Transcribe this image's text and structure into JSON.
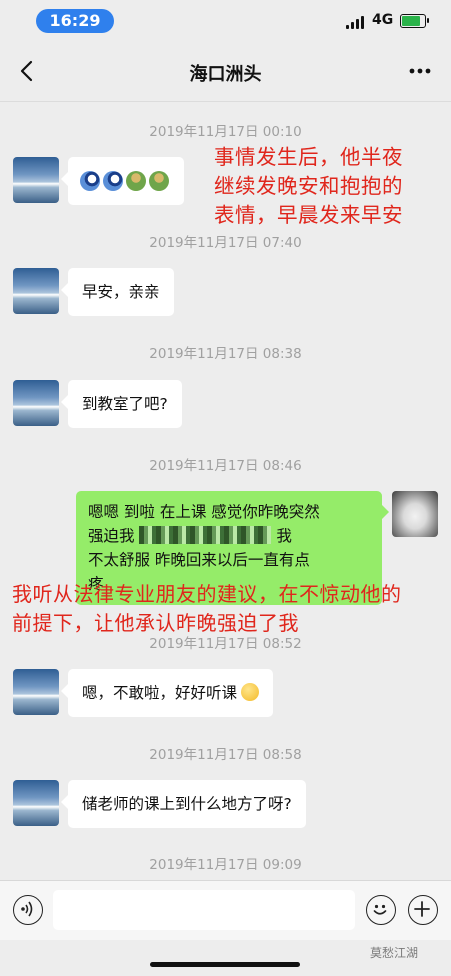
{
  "status_bar": {
    "time": "16:29",
    "network": "4G",
    "battery_level": 0.75,
    "battery_color": "#2ab34a",
    "time_pill_color": "#2f80ed"
  },
  "nav": {
    "title": "海口洲头",
    "back_icon": "chevron-left-icon",
    "more_icon": "more-dots-icon"
  },
  "messages": {
    "ts1": "2019年11月17日 00:10",
    "m1_stickers": [
      "moon-sticker",
      "moon-sticker",
      "hug-sticker",
      "hug-sticker"
    ],
    "ts2": "2019年11月17日 07:40",
    "m2": "早安，亲亲",
    "ts3": "2019年11月17日 08:38",
    "m3": "到教室了吧?",
    "ts4": "2019年11月17日 08:46",
    "m4_line1": "嗯嗯 到啦 在上课 感觉你昨晚突然",
    "m4_line2_start": "强迫我 ",
    "m4_line2_end": " 我",
    "m4_line3": "不太舒服 昨晚回来以后一直有点",
    "m4_line4": "疼",
    "ts5": "2019年11月17日 08:52",
    "m5": "嗯，不敢啦，好好听课",
    "ts6": "2019年11月17日 08:58",
    "m6": "储老师的课上到什么地方了呀?",
    "ts7": "2019年11月17日 09:09"
  },
  "annotations": {
    "a1_line1": "事情发生后，他半夜",
    "a1_line2": "继续发晚安和抱抱的",
    "a1_line3": "表情，早晨发来早安",
    "a2_line1": "我听从法律专业朋友的建议，在不惊动他的",
    "a2_line2": "前提下，让他承认昨晚强迫了我",
    "color": "#e0261c"
  },
  "input_bar": {
    "voice_icon": "voice-icon",
    "emoji_icon": "emoji-icon",
    "plus_icon": "plus-icon"
  },
  "watermark": "莫愁江湖",
  "colors": {
    "background": "#ededed",
    "outgoing_bubble": "#95ec69",
    "incoming_bubble": "#ffffff"
  }
}
